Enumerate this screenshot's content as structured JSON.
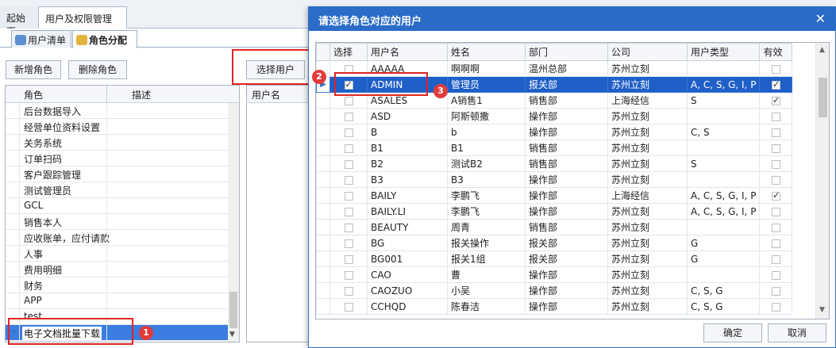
{
  "top_tabs": [
    "起始页",
    "用户及权限管理"
  ],
  "sub_tabs": [
    {
      "label": "用户清单",
      "icon": "users-icon"
    },
    {
      "label": "角色分配",
      "icon": "lock-icon"
    }
  ],
  "toolbar": {
    "add_role": "新增角色",
    "delete_role": "删除角色",
    "select_user": "选择用户"
  },
  "role_grid": {
    "headers": [
      "角色",
      "描述"
    ],
    "rows": [
      "后台数据导入",
      "经营单位资料设置",
      "关务系统",
      "订单扫码",
      "客户跟踪管理",
      "测试管理员",
      "GCL",
      "销售本人",
      "应收账单，应付请款",
      "人事",
      "费用明细",
      "财务",
      "APP",
      "test",
      "电子文档批量下载"
    ],
    "selected_index": 14
  },
  "user_grid": {
    "headers": [
      "用户名"
    ]
  },
  "dialog": {
    "title": "请选择角色对应的用户",
    "headers": [
      "选择",
      "用户名",
      "姓名",
      "部门",
      "公司",
      "用户类型",
      "有效"
    ],
    "rows": [
      {
        "select": false,
        "username": "AAAAA",
        "name": "啊啊啊",
        "dept": "温州总部",
        "company": "苏州立刻",
        "type": "",
        "valid": false
      },
      {
        "select": true,
        "username": "ADMIN",
        "name": "管理员",
        "dept": "报关部",
        "company": "苏州立刻",
        "type": "A, C, S, G, I, P",
        "valid": true
      },
      {
        "select": false,
        "username": "ASALES",
        "name": "A销售1",
        "dept": "销售部",
        "company": "上海经信",
        "type": "S",
        "valid": true
      },
      {
        "select": false,
        "username": "ASD",
        "name": "阿斯顿撒",
        "dept": "操作部",
        "company": "苏州立刻",
        "type": "",
        "valid": false
      },
      {
        "select": false,
        "username": "B",
        "name": "b",
        "dept": "操作部",
        "company": "苏州立刻",
        "type": "C, S",
        "valid": false
      },
      {
        "select": false,
        "username": "B1",
        "name": "B1",
        "dept": "销售部",
        "company": "苏州立刻",
        "type": "",
        "valid": false
      },
      {
        "select": false,
        "username": "B2",
        "name": "测试B2",
        "dept": "销售部",
        "company": "苏州立刻",
        "type": "S",
        "valid": false
      },
      {
        "select": false,
        "username": "B3",
        "name": "B3",
        "dept": "操作部",
        "company": "苏州立刻",
        "type": "",
        "valid": false
      },
      {
        "select": false,
        "username": "BAILY",
        "name": "李鹏飞",
        "dept": "操作部",
        "company": "上海经信",
        "type": "A, C, S, G, I, P",
        "valid": true
      },
      {
        "select": false,
        "username": "BAILY.LI",
        "name": "李鹏飞",
        "dept": "操作部",
        "company": "苏州立刻",
        "type": "A, C, S, G, I, P",
        "valid": false
      },
      {
        "select": false,
        "username": "BEAUTY",
        "name": "周青",
        "dept": "销售部",
        "company": "苏州立刻",
        "type": "",
        "valid": false
      },
      {
        "select": false,
        "username": "BG",
        "name": "报关操作",
        "dept": "报关部",
        "company": "苏州立刻",
        "type": "G",
        "valid": false
      },
      {
        "select": false,
        "username": "BG001",
        "name": "报关1组",
        "dept": "报关部",
        "company": "苏州立刻",
        "type": "G",
        "valid": false
      },
      {
        "select": false,
        "username": "CAO",
        "name": "曹",
        "dept": "操作部",
        "company": "苏州立刻",
        "type": "",
        "valid": false
      },
      {
        "select": false,
        "username": "CAOZUO",
        "name": "小吴",
        "dept": "操作部",
        "company": "苏州立刻",
        "type": "C, S, G",
        "valid": false
      },
      {
        "select": false,
        "username": "CCHQD",
        "name": "陈春洁",
        "dept": "操作部",
        "company": "苏州立刻",
        "type": "C, S, G",
        "valid": false
      }
    ],
    "selected_index": 1,
    "ok": "确定",
    "cancel": "取消"
  },
  "annotations": [
    "1",
    "2",
    "3"
  ]
}
